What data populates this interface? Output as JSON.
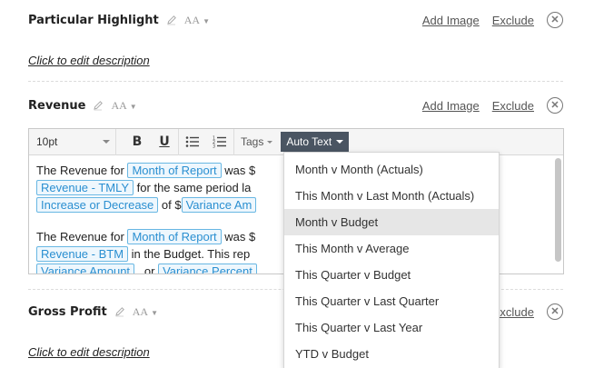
{
  "sections": [
    {
      "title": "Particular Highlight",
      "add_image": "Add Image",
      "exclude": "Exclude",
      "description": "Click to edit description"
    },
    {
      "title": "Revenue",
      "add_image": "Add Image",
      "exclude": "Exclude"
    },
    {
      "title": "Gross Profit",
      "exclude": "Exclude",
      "description": "Click to edit description"
    }
  ],
  "format_icon_text": "AA",
  "toolbar": {
    "font_size": "10pt",
    "bold": "B",
    "underline": "U",
    "tags_label": "Tags",
    "auto_text_label": "Auto Text"
  },
  "editor_content": {
    "p1": {
      "t1": "The Revenue for ",
      "tag1": "Month of Report",
      "t2": " was $",
      "tag2": "Revenue - TMLY",
      "t3": " for the same period la",
      "tag3": "Increase or Decrease",
      "t4": " of $",
      "tag4": "Variance Am"
    },
    "p2": {
      "t1": "The Revenue for ",
      "tag1": "Month of Report",
      "t2": " was $",
      "tag2": "Revenue - BTM",
      "t3": " in the Budget. This rep",
      "tag3": "Variance Amount",
      "t4": " , or ",
      "tag4": "Variance Percent"
    }
  },
  "auto_text_menu": {
    "items": [
      "Month v Month (Actuals)",
      "This Month v Last Month (Actuals)",
      "Month v Budget",
      "This Month v Average",
      "This Quarter v Budget",
      "This Quarter v Last Quarter",
      "This Quarter v Last Year",
      "YTD v Budget"
    ],
    "highlighted": "Month v Budget"
  },
  "colors": {
    "tag_border": "#68b7e3",
    "tag_text": "#2a8fd1",
    "auto_text_bg": "#4a5562",
    "menu_highlight": "#e6e6e6"
  },
  "icons": [
    "pencil-icon",
    "font-size-icon",
    "close-circle-icon",
    "bullet-list-icon",
    "numbered-list-icon",
    "chevron-down-icon"
  ]
}
